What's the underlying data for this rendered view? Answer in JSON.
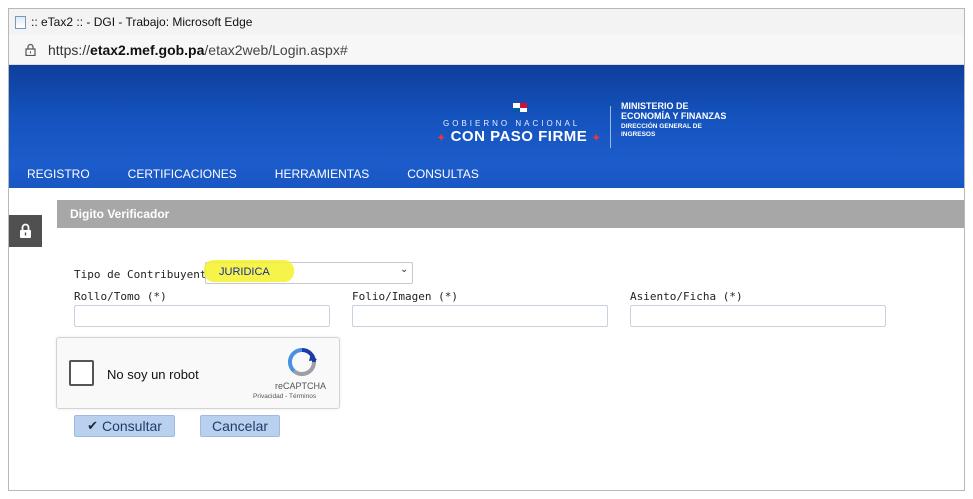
{
  "browser": {
    "title": ":: eTax2 :: - DGI - Trabajo: Microsoft Edge",
    "url_prefix": "https://",
    "url_domain": "etax2.mef.gob.pa",
    "url_path": "/etax2web/Login.aspx#"
  },
  "banner": {
    "gobierno_nacional": "GOBIERNO NACIONAL",
    "paso_firme": "CON PASO FIRME",
    "ministerio_line1": "MINISTERIO DE",
    "ministerio_line2": "ECONOMÍA Y FINANZAS",
    "dgi_line1": "DIRECCIÓN GENERAL DE",
    "dgi_line2": "INGRESOS",
    "bg_color": "#1554bf"
  },
  "nav": {
    "items": [
      "REGISTRO",
      "CERTIFICACIONES",
      "HERRAMIENTAS",
      "CONSULTAS"
    ]
  },
  "section": {
    "title": "Digito Verificador"
  },
  "form": {
    "tipo_label": "Tipo de Contribuyente:",
    "tipo_value": "JURIDICA",
    "rollo_label": "Rollo/Tomo (*)",
    "folio_label": "Folio/Imagen (*)",
    "asiento_label": "Asiento/Ficha (*)",
    "rollo_value": "",
    "folio_value": "",
    "asiento_value": ""
  },
  "captcha": {
    "label": "No soy un robot",
    "brand": "reCAPTCHA",
    "links": "Privacidad - Términos"
  },
  "buttons": {
    "consultar": "Consultar",
    "cancelar": "Cancelar"
  },
  "colors": {
    "highlight": "#f5f22a",
    "section_header": "#a7a7a7",
    "button_bg": "#b9d1ef"
  }
}
